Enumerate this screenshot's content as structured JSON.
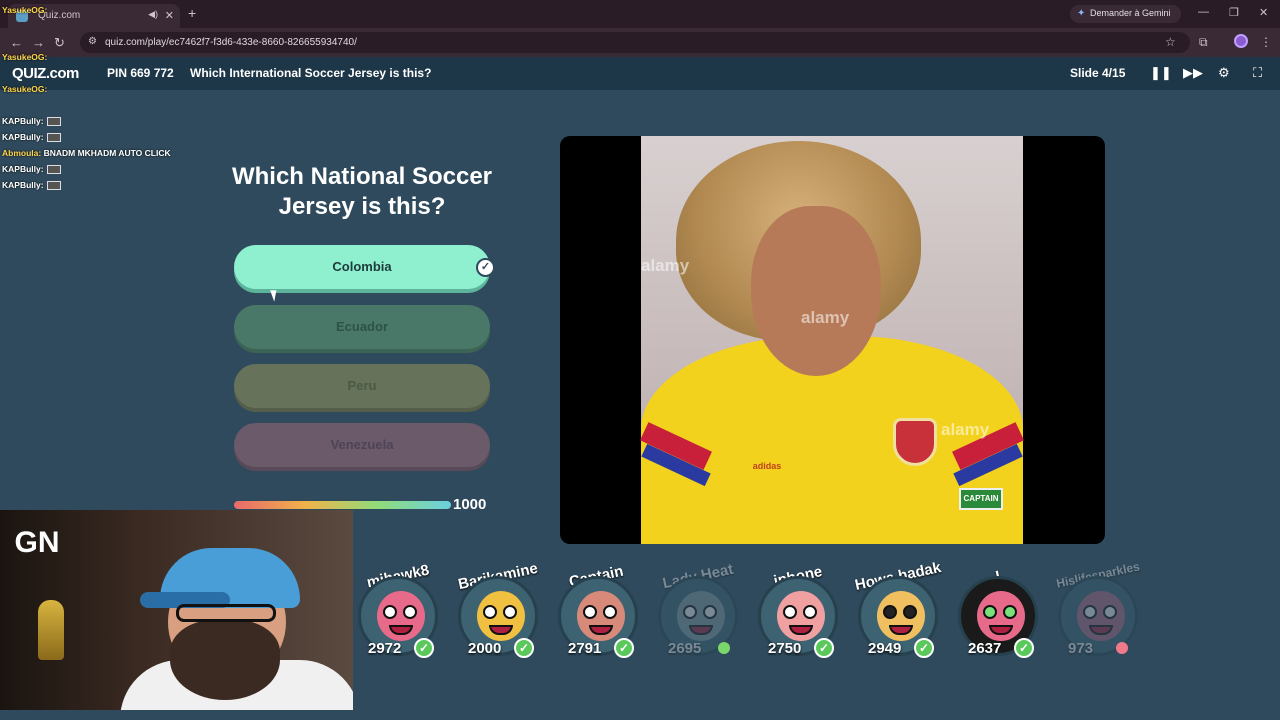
{
  "browser": {
    "tab_title": "Quiz.com",
    "url": "quiz.com/play/ec7462f7-f3d6-433e-8660-826655934740/",
    "gemini_label": "Demander à Gemini"
  },
  "header": {
    "logo": "QUIZ.com",
    "pin": "PIN 669 772",
    "title": "Which International Soccer Jersey is this?",
    "slide": "Slide 4/15"
  },
  "chat": [
    {
      "user": "YasukeOG:",
      "text": ""
    },
    {
      "user": "YasukeOG:",
      "text": ""
    },
    {
      "user": "YasukeOG:",
      "text": ""
    },
    {
      "user": "KAPBully:",
      "text": ""
    },
    {
      "user": "KAPBully:",
      "text": ""
    },
    {
      "user": "Abmoula:",
      "text": "BNADM MKHADM AUTO CLICK"
    },
    {
      "user": "KAPBully:",
      "text": ""
    },
    {
      "user": "KAPBully:",
      "text": ""
    }
  ],
  "question": "Which National Soccer Jersey is this?",
  "answers": [
    {
      "label": "Colombia",
      "correct": true
    },
    {
      "label": "Ecuador",
      "correct": false
    },
    {
      "label": "Peru",
      "correct": false
    },
    {
      "label": "Venezuela",
      "correct": false
    }
  ],
  "timer": {
    "value": "1000",
    "fill_percent": 100
  },
  "image": {
    "watermark": "alamy",
    "brand": "adidas",
    "armband": "CAPTAIN"
  },
  "webcam": {
    "logo": "GN"
  },
  "players": [
    {
      "name": "mihawk8",
      "score": "2972",
      "status": "correct",
      "color": "#e86a8a"
    },
    {
      "name": "Barikamine",
      "score": "2000",
      "status": "correct",
      "color": "#f0c040"
    },
    {
      "name": "Captain Wasp",
      "score": "2791",
      "status": "correct",
      "color": "#d88a7a"
    },
    {
      "name": "Lady Heat",
      "score": "2695",
      "status": "pending",
      "color": "#8aa0a8"
    },
    {
      "name": "iphone",
      "score": "2750",
      "status": "correct",
      "color": "#f0a0a0"
    },
    {
      "name": "Howa hadak",
      "score": "2949",
      "status": "correct",
      "color": "#f0c060"
    },
    {
      "name": "I",
      "score": "2637",
      "status": "correct",
      "color": "#e86a8a"
    },
    {
      "name": "Hislifesparkles",
      "score": "973",
      "status": "wrong",
      "color": "#c06a8a"
    }
  ],
  "colors": {
    "background": "#2f4a5c",
    "correct_answer": "#8ff0d0",
    "check": "#5ac85a"
  }
}
